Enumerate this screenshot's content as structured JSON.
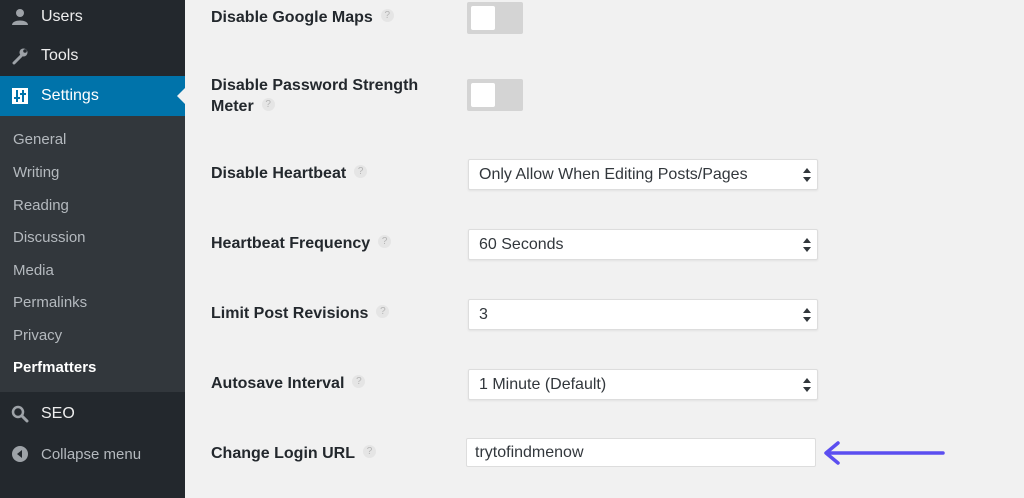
{
  "sidebar": {
    "top_items": [
      {
        "label": "Users",
        "icon": "users-icon"
      },
      {
        "label": "Tools",
        "icon": "wrench-icon"
      },
      {
        "label": "Settings",
        "icon": "settings-icon"
      }
    ],
    "sub_items": [
      "General",
      "Writing",
      "Reading",
      "Discussion",
      "Media",
      "Permalinks",
      "Privacy",
      "Perfmatters"
    ],
    "seo_label": "SEO",
    "collapse_label": "Collapse menu",
    "active_color": "#0073aa"
  },
  "settings": {
    "disable_google_maps": {
      "label": "Disable Google Maps",
      "enabled": false
    },
    "disable_password_meter": {
      "label_line1": "Disable Password Strength",
      "label_line2": "Meter",
      "enabled": false
    },
    "disable_heartbeat": {
      "label": "Disable Heartbeat",
      "value": "Only Allow When Editing Posts/Pages"
    },
    "heartbeat_frequency": {
      "label": "Heartbeat Frequency",
      "value": "60 Seconds"
    },
    "limit_post_revisions": {
      "label": "Limit Post Revisions",
      "value": "3"
    },
    "autosave_interval": {
      "label": "Autosave Interval",
      "value": "1 Minute (Default)"
    },
    "change_login_url": {
      "label": "Change Login URL",
      "value": "trytofindmenow"
    },
    "help_glyph": "?"
  },
  "annotation_color": "#5b4ef0"
}
